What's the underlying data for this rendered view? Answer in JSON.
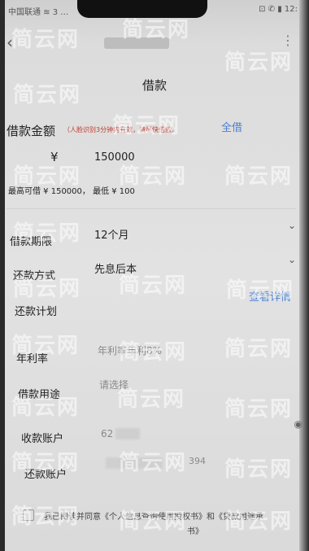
{
  "status_bar": {
    "left": "中国联通 ≋ 3 …",
    "right": "⊡ ✆ ▮ 12:"
  },
  "page_title": "借款",
  "amount": {
    "label": "借款金额",
    "hint": "（人脸识别3分钟内有效，请尽快借款）",
    "all_link": "全借",
    "currency": "¥",
    "value": "150000",
    "limits": "最高可借 ¥ 150000， 最低 ¥ 100"
  },
  "term": {
    "label": "借款期限",
    "value": "12个月"
  },
  "repay_method": {
    "label": "还款方式",
    "value": "先息后本"
  },
  "repay_plan": {
    "label": "还款计划",
    "link": "查看详情"
  },
  "rate": {
    "label": "年利率",
    "value": "年利率年利8%"
  },
  "purpose": {
    "label": "借款用途",
    "placeholder": "请选择"
  },
  "receive_account": {
    "label": "收款账户",
    "value_prefix": "62"
  },
  "repay_account": {
    "label": "还款账户",
    "value_suffix": "394"
  },
  "agreement": {
    "text": "我已阅读并同意《个人信息查询使用授权书》和《贷款用途承",
    "text2": "书》"
  },
  "watermark": "简云网"
}
